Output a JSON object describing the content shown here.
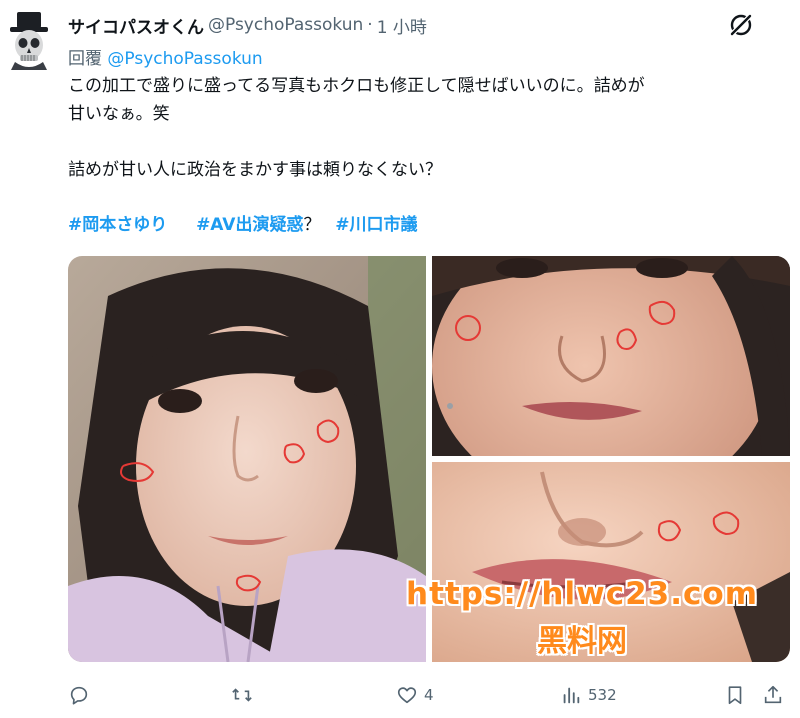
{
  "tweet": {
    "display_name": "サイコパスオくん",
    "handle": "@PsychoPassokun",
    "separator": "·",
    "time": "1 小時",
    "reply_prefix": "回覆",
    "reply_mention": "@PsychoPassokun",
    "body_lines": [
      "この加工で盛りに盛ってる写真もホクロも修正して隠せばいいのに。詰めが",
      "甘いなぁ。笑",
      "",
      "詰めが甘い人に政治をまかす事は頼りなくない？"
    ],
    "hashtags": [
      {
        "text": "#岡本さゆり",
        "is_tag": true
      },
      {
        "text": "#AV出演疑惑",
        "is_tag": true
      },
      {
        "text": "？",
        "is_tag": false
      },
      {
        "text": "#川口市議",
        "is_tag": true
      }
    ]
  },
  "watermark": {
    "url": "https://hlwc23.com",
    "sub": "黑料网"
  },
  "actions": {
    "reply_icon": "reply-icon",
    "retweet_icon": "retweet-icon",
    "like_icon": "heart-icon",
    "like_count": "4",
    "views_icon": "views-icon",
    "views_count": "532",
    "bookmark_icon": "bookmark-icon",
    "share_icon": "share-icon"
  },
  "colors": {
    "accent": "#1d9bf0",
    "text": "#0f1419",
    "secondary": "#536471",
    "watermark": "#ff8a1c",
    "annotation": "#e53935"
  }
}
